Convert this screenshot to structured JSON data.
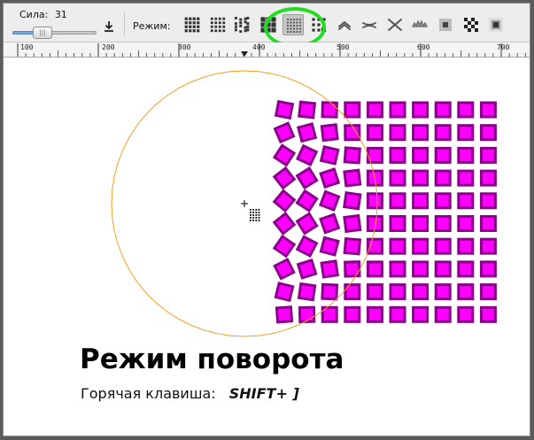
{
  "toolbar": {
    "strength_label": "Сила:",
    "strength_value": "31",
    "strength_fraction": 0.31,
    "download_icon": "download-arrow-icon",
    "mode_label": "Режим:",
    "modes": [
      {
        "name": "mode-move-icon",
        "active": false
      },
      {
        "name": "mode-move-in-out-icon",
        "active": false
      },
      {
        "name": "mode-jitter-icon",
        "active": false
      },
      {
        "name": "mode-scale-icon",
        "active": false
      },
      {
        "name": "mode-rotate-icon",
        "active": true
      },
      {
        "name": "mode-duplicate-icon",
        "active": false
      },
      {
        "name": "mode-push-icon",
        "active": false
      },
      {
        "name": "mode-shrink-icon",
        "active": false
      },
      {
        "name": "mode-attract-repel-icon",
        "active": false
      },
      {
        "name": "mode-roughen-icon",
        "active": false
      },
      {
        "name": "mode-paint-icon",
        "active": false
      },
      {
        "name": "mode-jitter-color-icon",
        "active": false
      },
      {
        "name": "mode-blur-icon",
        "active": false
      }
    ],
    "highlight_color": "#22dd22"
  },
  "ruler": {
    "labels": [
      "100",
      "200",
      "300",
      "400",
      "500",
      "600",
      "700"
    ]
  },
  "canvas": {
    "circle_color": "#f0a020",
    "square_fill": "#ff00ff",
    "square_stroke": "#8a008a"
  },
  "caption": {
    "title": "Режим поворота",
    "hotkey_label": "Горячая клавиша:",
    "hotkey_value": "SHIFT+ ]"
  }
}
